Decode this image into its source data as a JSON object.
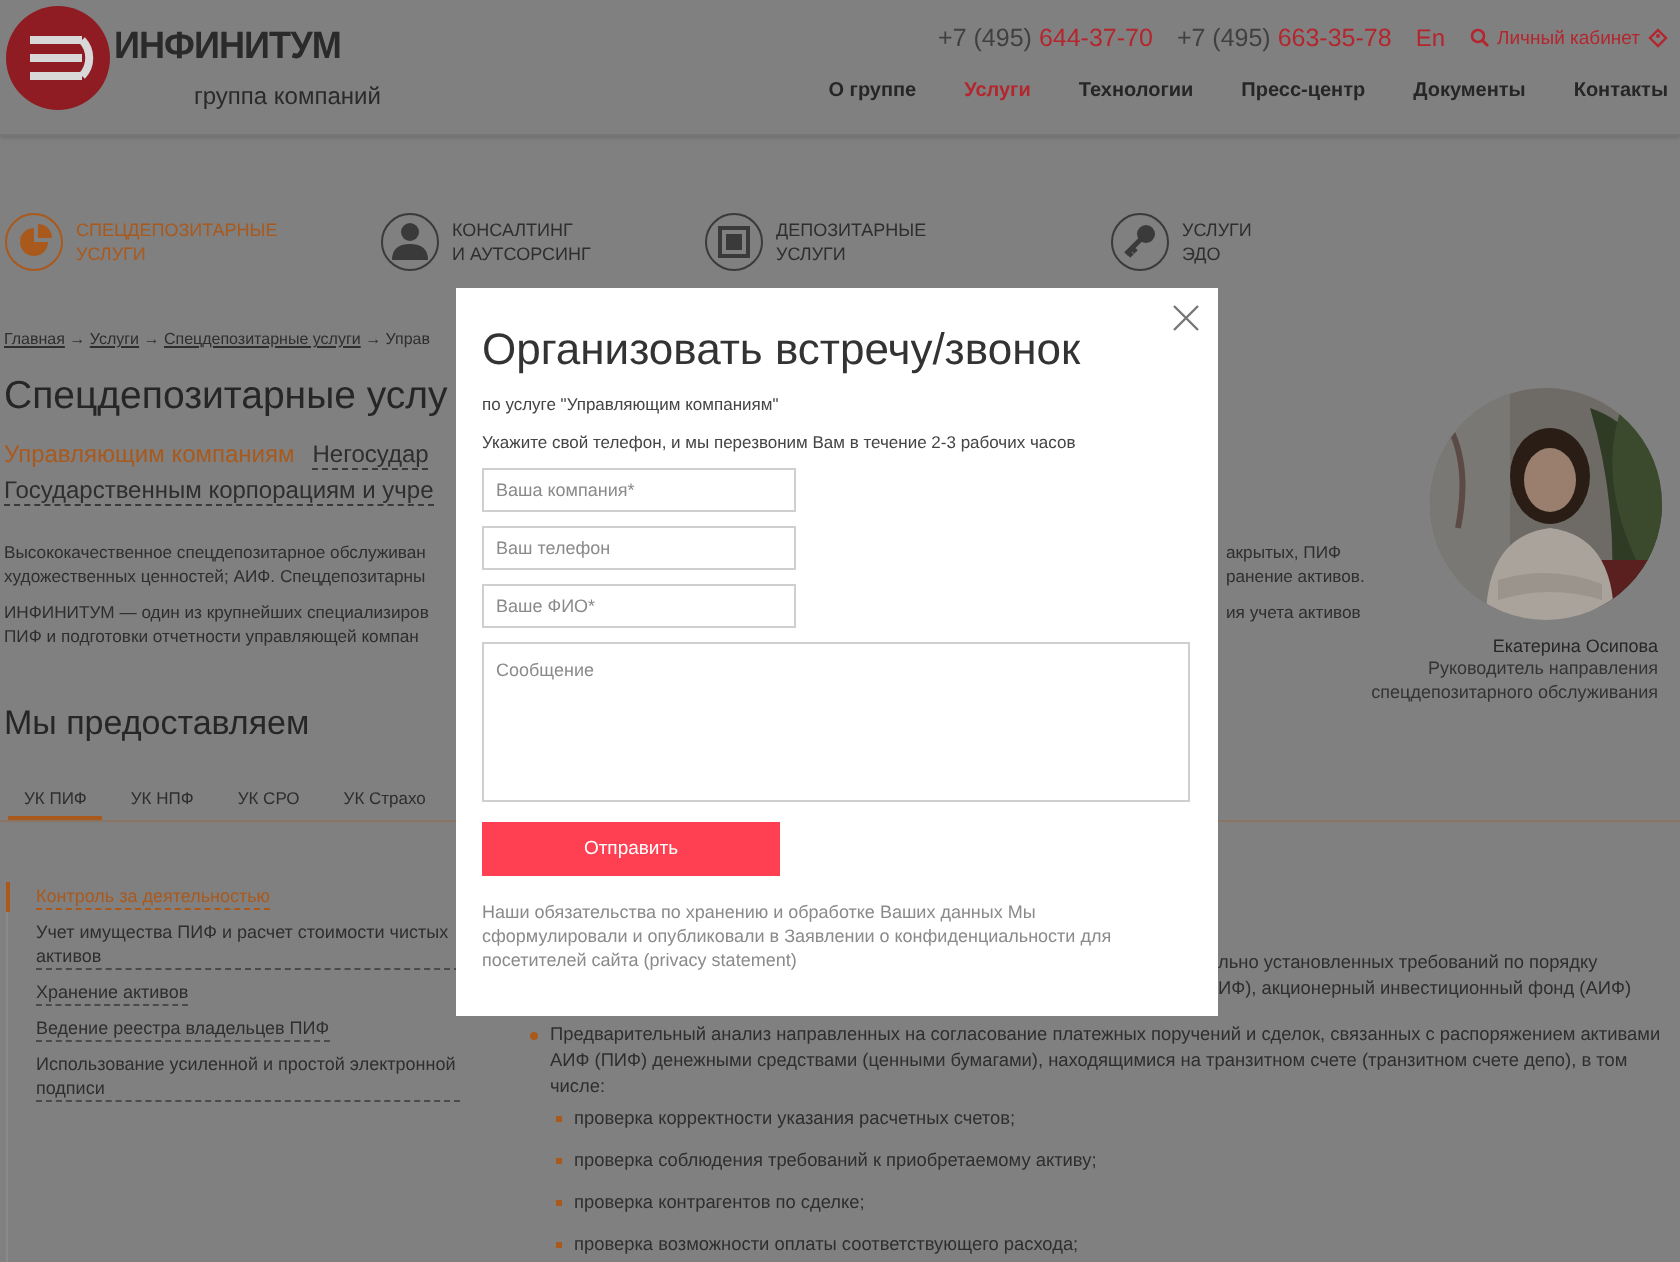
{
  "header": {
    "logo": {
      "name": "ИНФИНИТУМ",
      "tagline": "группа компаний"
    },
    "phones": [
      {
        "code": "+7 (495)",
        "number": "644-37-70"
      },
      {
        "code": "+7 (495)",
        "number": "663-35-78"
      }
    ],
    "language": "En",
    "account": "Личный кабинет",
    "nav": [
      {
        "label": "О группе",
        "selected": false
      },
      {
        "label": "Услуги",
        "selected": true
      },
      {
        "label": "Технологии",
        "selected": false
      },
      {
        "label": "Пресс-центр",
        "selected": false
      },
      {
        "label": "Документы",
        "selected": false
      },
      {
        "label": "Контакты",
        "selected": false
      }
    ]
  },
  "services": [
    {
      "label": "СПЕЦДЕПОЗИТАРНЫЕ\nУСЛУГИ",
      "kind": "pie",
      "selected": true
    },
    {
      "label": "КОНСАЛТИНГ\nИ АУТСОРСИНГ",
      "kind": "person",
      "selected": false
    },
    {
      "label": "ДЕПОЗИТАРНЫЕ\nУСЛУГИ",
      "kind": "safe",
      "selected": false
    },
    {
      "label": "УСЛУГИ\nЭДО",
      "kind": "key",
      "selected": false
    }
  ],
  "breadcrumb": {
    "separator": "→",
    "items": [
      {
        "label": "Главная",
        "current": false
      },
      {
        "label": "Услуги",
        "current": false
      },
      {
        "label": "Спецдепозитарные услуги",
        "current": false
      },
      {
        "label": "Управ",
        "current": true
      }
    ]
  },
  "page_title": "Спецдепозитарные услу",
  "audiences": [
    {
      "label": "Управляющим компаниям",
      "selected": true
    },
    {
      "label": "Негосудар",
      "selected": false
    },
    {
      "label": "Государственным корпорациям и учре",
      "selected": false
    }
  ],
  "intro": [
    {
      "lines": [
        {
          "left": "Высококачественное спецдепозитарное обслуживан",
          "right": "акрытых, ПИФ"
        },
        {
          "left": "художественных ценностей; АИФ. Спецдепозитарны",
          "right": "ранение активов."
        }
      ]
    },
    {
      "lines": [
        {
          "left": "ИНФИНИТУМ — один из крупнейших специализиров",
          "right": "ия учета активов"
        },
        {
          "left": "ПИФ и подготовки отчетности управляющей компан"
        }
      ]
    }
  ],
  "expert": {
    "name": "Екатерина Осипова",
    "role": "Руководитель направления\nспецдепозитарного обслуживания"
  },
  "section_title": "Мы предоставляем",
  "tabs": [
    {
      "label": "УК ПИФ",
      "selected": true
    },
    {
      "label": "УК НПФ",
      "selected": false
    },
    {
      "label": "УК СРО",
      "selected": false
    },
    {
      "label": "УК Страхо",
      "selected": false
    }
  ],
  "side_menu": [
    {
      "label": "Контроль за деятельностью",
      "selected": true
    },
    {
      "label": "Учет имущества ПИФ и расчет стоимости чистых активов",
      "selected": false
    },
    {
      "label": "Хранение активов",
      "selected": false
    },
    {
      "label": "Ведение реестра владельцев ПИФ",
      "selected": false
    },
    {
      "label": "Использование усиленной и простой электронной подписи",
      "selected": false
    }
  ],
  "content": {
    "fragments": [
      "льно установленных требований по порядку",
      "ИФ), акционерный инвестиционный фонд (АИФ)"
    ],
    "bullets": [
      {
        "text": "Предварительный анализ направленных на согласование платежных поручений и сделок, связанных с распоряжением активами АИФ (ПИФ) денежными средствами (ценными бумагами), находящимися на транзитном счете (транзитном счете депо), в том числе:",
        "children": [
          {
            "text": "проверка корректности указания расчетных счетов;"
          },
          {
            "text": "проверка соблюдения требований к приобретаемому активу;"
          },
          {
            "text": "проверка контрагентов по сделке;"
          },
          {
            "text": "проверка возможности оплаты соответствующего расхода;"
          }
        ]
      }
    ]
  },
  "modal": {
    "title": "Организовать встречу/звонок",
    "service": "по услуге \"Управляющим компаниям\"",
    "hint": "Укажите свой телефон, и мы перезвоним Вам в течение 2-3 рабочих часов",
    "fields": [
      {
        "kind": "input",
        "placeholder": "Ваша компания*"
      },
      {
        "kind": "input",
        "placeholder": "Ваш телефон"
      },
      {
        "kind": "input",
        "placeholder": "Ваше ФИО*"
      },
      {
        "kind": "textarea",
        "placeholder": "Сообщение"
      }
    ],
    "submit": "Отправить",
    "note": "Наши обязательства по хранению и обработке Ваших данных Мы сформулировали и опубликовали в Заявлении о конфиденциальности для посетителей сайта (privacy statement)"
  }
}
